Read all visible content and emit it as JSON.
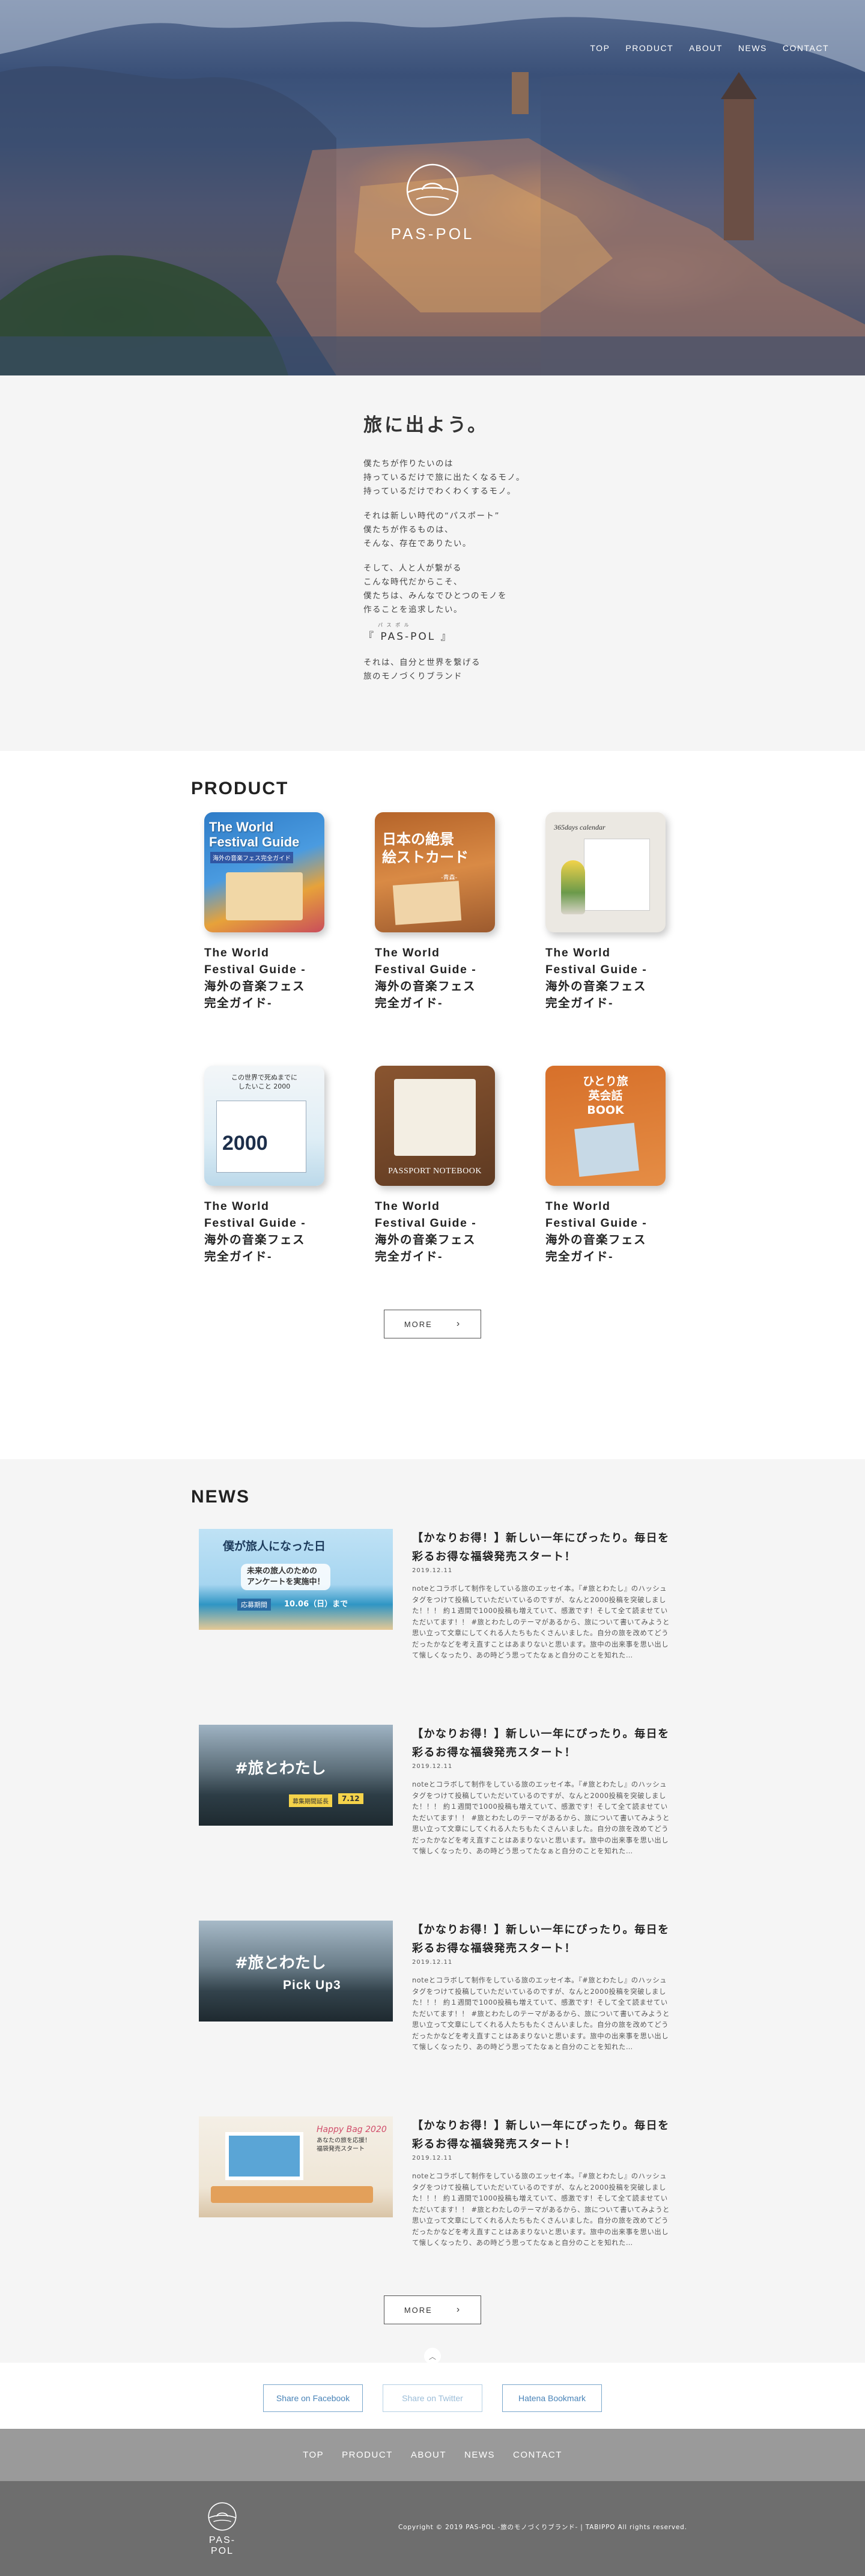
{
  "nav": {
    "items": [
      "TOP",
      "PRODUCT",
      "ABOUT",
      "NEWS",
      "CONTACT"
    ]
  },
  "hero": {
    "brand": "PAS-POL"
  },
  "intro": {
    "title": "旅に出よう。",
    "para1": "僕たちが作りたいのは\n持っているだけで旅に出たくなるモノ。\n持っているだけでわくわくするモノ。",
    "para2": "それは新しい時代の“パスポート”\n僕たちが作るものは、\nそんな、存在でありたい。",
    "para3": "そして、人と人が繋がる\nこんな時代だからこそ、\n僕たちは、みんなでひとつのモノを\n作ることを追求したい。",
    "brand_line": "『 PAS-POL 』",
    "brand_ruby": "パ ス ポ ル",
    "para4": "それは、自分と世界を繋げる\n旅のモノづくりブランド"
  },
  "product": {
    "heading": "PRODUCT",
    "items": [
      {
        "name": "The World\nFestival Guide -\n海外の音楽フェス\n完全ガイド-",
        "cover_text": "The World\nFestival Guide",
        "cover_sub": "海外の音楽フェス完全ガイド",
        "cover_color": "#3a83c9"
      },
      {
        "name": "The World\nFestival Guide -\n海外の音楽フェス\n完全ガイド-",
        "cover_text": "日本の絶景\n絵ストカード",
        "cover_sub": "-青森-",
        "cover_color": "#c8722f"
      },
      {
        "name": "The World\nFestival Guide -\n海外の音楽フェス\n完全ガイド-",
        "cover_text": "365days calendar",
        "cover_sub": "",
        "cover_color": "#e9e6df"
      },
      {
        "name": "The World\nFestival Guide -\n海外の音楽フェス\n完全ガイド-",
        "cover_text": "この世界で死ぬまでに\nしたいこと 2000",
        "cover_sub": "2000",
        "cover_color": "#eaf2f7"
      },
      {
        "name": "The World\nFestival Guide -\n海外の音楽フェス\n完全ガイド-",
        "cover_text": "PASSPORT NOTEBOOK",
        "cover_sub": "",
        "cover_color": "#7a4a2a"
      },
      {
        "name": "The World\nFestival Guide -\n海外の音楽フェス\n完全ガイド-",
        "cover_text": "ひとり旅\n英会話\nBOOK",
        "cover_sub": "",
        "cover_color": "#d9782e"
      }
    ],
    "more_label": "MORE"
  },
  "news": {
    "heading": "NEWS",
    "items": [
      {
        "title": "【かなりお得！】新しい一年にぴったり。毎日を彩るお得な福袋発売スタート！",
        "date": "2019.12.11",
        "text": "noteとコラボして制作をしている旅のエッセイ本。『#旅とわたし』のハッシュタグをつけて投稿していただいているのですが、なんと2000投稿を突破しました！！！ 約１週間で1000投稿も増えていて、感激です！そして全て読ませていただいてます！！ #旅とわたしのテーマがあるから、旅について書いてみようと思い立って文章にしてくれる人たちもたくさんいました。自分の旅を改めてどうだったかなどを考え直すことはあまりないと思います。旅中の出来事を思い出して懐しくなったり、あの時どう思ってたなぁと自分のことを知れた…",
        "thumb_title": "僕が旅人になった日",
        "thumb_sub": "未来の旅人のための\nアンケートを実施中！",
        "thumb_badge": "応募期間",
        "thumb_date": "10.06（日）まで"
      },
      {
        "title": "【かなりお得！】新しい一年にぴったり。毎日を彩るお得な福袋発売スタート！",
        "date": "2019.12.11",
        "text": "noteとコラボして制作をしている旅のエッセイ本。『#旅とわたし』のハッシュタグをつけて投稿していただいているのですが、なんと2000投稿を突破しました！！！ 約１週間で1000投稿も増えていて、感激です！そして全て読ませていただいてます！！ #旅とわたしのテーマがあるから、旅について書いてみようと思い立って文章にしてくれる人たちもたくさんいました。自分の旅を改めてどうだったかなどを考え直すことはあまりないと思います。旅中の出来事を思い出して懐しくなったり、あの時どう思ってたなぁと自分のことを知れた…",
        "thumb_title": "#旅とわたし",
        "thumb_sub": "",
        "thumb_badge": "募集期間延長",
        "thumb_date": "7.12"
      },
      {
        "title": "【かなりお得！】新しい一年にぴったり。毎日を彩るお得な福袋発売スタート！",
        "date": "2019.12.11",
        "text": "noteとコラボして制作をしている旅のエッセイ本。『#旅とわたし』のハッシュタグをつけて投稿していただいているのですが、なんと2000投稿を突破しました！！！ 約１週間で1000投稿も増えていて、感激です！そして全て読ませていただいてます！！ #旅とわたしのテーマがあるから、旅について書いてみようと思い立って文章にしてくれる人たちもたくさんいました。自分の旅を改めてどうだったかなどを考え直すことはあまりないと思います。旅中の出来事を思い出して懐しくなったり、あの時どう思ってたなぁと自分のことを知れた…",
        "thumb_title": "#旅とわたし",
        "thumb_sub": "Pick Up3",
        "thumb_badge": "",
        "thumb_date": ""
      },
      {
        "title": "【かなりお得！】新しい一年にぴったり。毎日を彩るお得な福袋発売スタート！",
        "date": "2019.12.11",
        "text": "noteとコラボして制作をしている旅のエッセイ本。『#旅とわたし』のハッシュタグをつけて投稿していただいているのですが、なんと2000投稿を突破しました！！！ 約１週間で1000投稿も増えていて、感激です！そして全て読ませていただいてます！！ #旅とわたしのテーマがあるから、旅について書いてみようと思い立って文章にしてくれる人たちもたくさんいました。自分の旅を改めてどうだったかなどを考え直すことはあまりないと思います。旅中の出来事を思い出して懐しくなったり、あの時どう思ってたなぁと自分のことを知れた…",
        "thumb_title": "Happy Bag 2020",
        "thumb_sub": "あなたの旅を応援！\n福袋発売スタート",
        "thumb_badge": "",
        "thumb_date": ""
      }
    ],
    "more_label": "MORE"
  },
  "share": {
    "facebook": "Share on Facebook",
    "twitter": "Share on Twitter",
    "hatena": "Hatena Bookmark"
  },
  "footer": {
    "nav": [
      "TOP",
      "PRODUCT",
      "ABOUT",
      "NEWS",
      "CONTACT"
    ],
    "brand": "PAS-POL",
    "copyright": "Copyright © 2019 PAS-POL -旅のモノづくりブランド- | TABIPPO All rights reserved."
  }
}
